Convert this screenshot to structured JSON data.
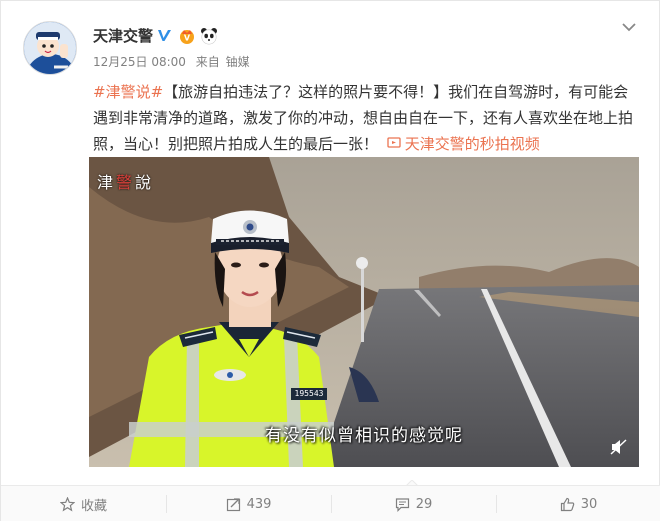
{
  "post": {
    "username": "天津交警",
    "time": "12月25日 08:00",
    "from_label": "来自",
    "source": "铀媒",
    "tag": "#津警说#",
    "text_main": "【旅游自拍违法了？这样的照片要不得！】我们在自驾游时，有可能会遇到非常清净的道路，激发了你的冲动，想自由自在一下，还有人喜欢坐在地上拍照，当心！别把照片拍成人生的最后一张！",
    "video_link": "天津交警的秒拍视频"
  },
  "video": {
    "watermark_pre": "津",
    "watermark_emph": "警",
    "watermark_post": "說",
    "subtitle": "有没有似曾相识的感觉呢",
    "badge_number": "195543"
  },
  "actions": {
    "favorite_label": "收藏",
    "repost_count": "439",
    "comment_count": "29",
    "like_count": "30"
  },
  "colors": {
    "link": "#eb7350",
    "verified": "#2f8fe6",
    "vest": "#d8f52a"
  },
  "icons": [
    "avatar",
    "verified-icon",
    "vip-badge-icon",
    "panda-badge-icon",
    "chevron-down-icon",
    "video-link-icon",
    "mute-icon",
    "star-icon",
    "repost-icon",
    "comment-icon",
    "like-icon"
  ]
}
